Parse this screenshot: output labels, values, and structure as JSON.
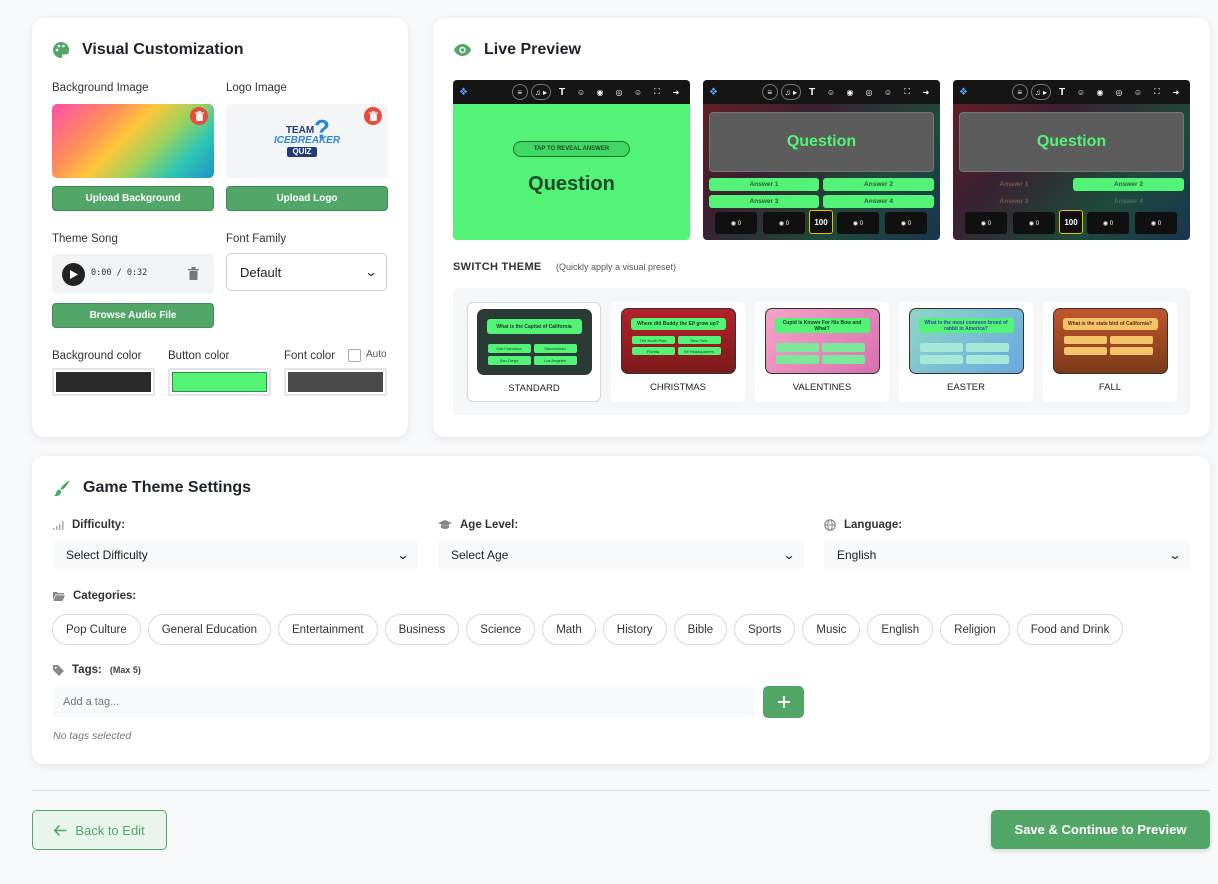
{
  "visual": {
    "title": "Visual Customization",
    "bg_image_label": "Background Image",
    "logo_image_label": "Logo Image",
    "upload_bg": "Upload Background",
    "upload_logo": "Upload Logo",
    "logo_text": {
      "team": "TEAM",
      "icebreaker": "ICEBREAKER",
      "quiz": "QUIZ"
    },
    "theme_song_label": "Theme Song",
    "audio_time": "0:00 / 0:32",
    "browse_audio": "Browse Audio File",
    "font_family_label": "Font Family",
    "font_family_value": "Default",
    "bg_color_label": "Background color",
    "btn_color_label": "Button color",
    "font_color_label": "Font color",
    "auto_label": "Auto",
    "colors": {
      "background": "#2b2b2b",
      "button": "#53f376",
      "font": "#4a4a4a"
    }
  },
  "preview": {
    "title": "Live Preview",
    "reveal": "TAP TO REVEAL ANSWER",
    "question": "Question",
    "answers": [
      "Answer 1",
      "Answer 2",
      "Answer 3",
      "Answer 4"
    ],
    "center_score": "100",
    "switch_theme": "SWITCH THEME",
    "switch_hint": "(Quickly apply a visual preset)",
    "themes": [
      {
        "name": "STANDARD",
        "question": "What is the Capital of California",
        "answers": [
          "San Francisco",
          "Sacramento",
          "San Diego",
          "Los Angeles"
        ]
      },
      {
        "name": "CHRISTMAS",
        "question": "Where did Buddy the Elf grow up?",
        "answers": [
          "The North Pole",
          "New York",
          "Florida",
          "Elf Headquarters"
        ]
      },
      {
        "name": "VALENTINES",
        "question": "Cupid is Known For His Bow and What?",
        "answers": [
          "",
          "",
          "",
          ""
        ]
      },
      {
        "name": "EASTER",
        "question": "What is the most common breed of rabbit in America?",
        "answers": [
          "",
          "",
          "",
          ""
        ]
      },
      {
        "name": "FALL",
        "question": "What is the state bird of California?",
        "answers": [
          "",
          "",
          "",
          ""
        ]
      }
    ]
  },
  "game": {
    "title": "Game Theme Settings",
    "difficulty_label": "Difficulty:",
    "difficulty_value": "Select Difficulty",
    "age_label": "Age Level:",
    "age_value": "Select Age",
    "language_label": "Language:",
    "language_value": "English",
    "categories_label": "Categories:",
    "categories": [
      "Pop Culture",
      "General Education",
      "Entertainment",
      "Business",
      "Science",
      "Math",
      "History",
      "Bible",
      "Sports",
      "Music",
      "English",
      "Religion",
      "Food and Drink"
    ],
    "tags_label": "Tags:",
    "tags_max": "(Max 5)",
    "tag_placeholder": "Add a tag...",
    "no_tags": "No tags selected"
  },
  "footer": {
    "back": "Back to Edit",
    "save": "Save & Continue to Preview"
  },
  "accent": "#52a668"
}
